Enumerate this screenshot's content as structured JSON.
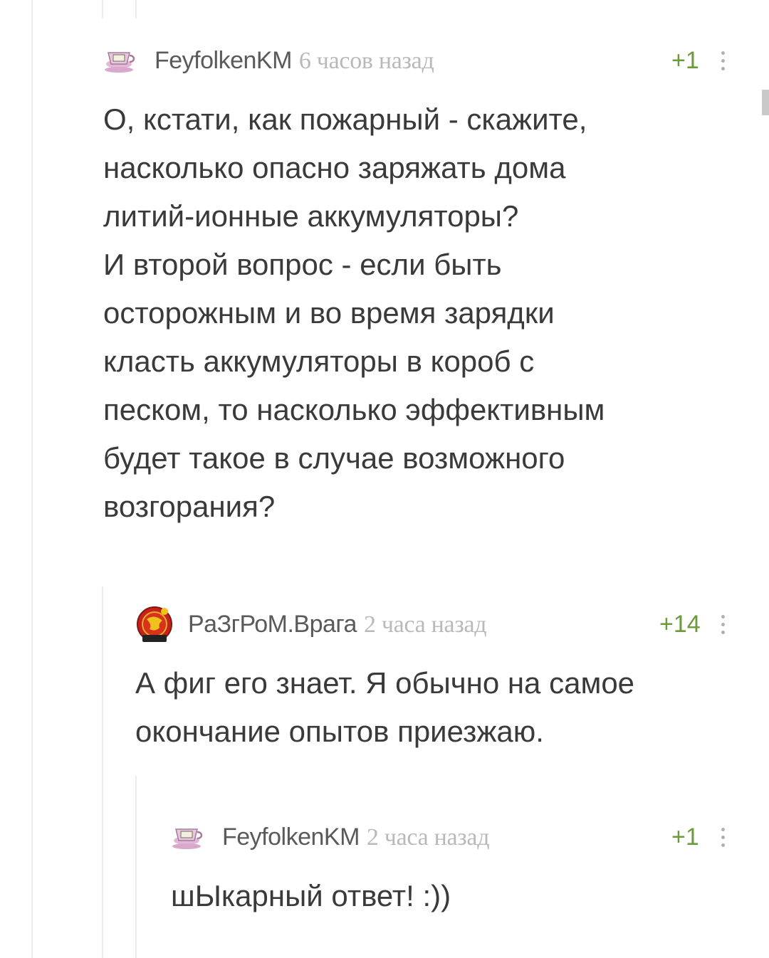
{
  "comments": [
    {
      "author": "FeyfolkenKM",
      "time": "6 часов назад",
      "rating": "+1",
      "text": "О, кстати, как пожарный - скажите,\nнасколько опасно заряжать дома\nлитий-ионные аккумуляторы?\nИ второй вопрос - если быть\nосторожным и во время зарядки\nкласть аккумуляторы в короб с\nпеском, то насколько эффективным\nбудет такое в случае возможного\nвозгорания?",
      "avatar_icon": "teacup-avatar-icon"
    },
    {
      "author": "PaЗгРоМ.Врага",
      "time": "2 часа назад",
      "rating": "+14",
      "text": "А фиг его знает. Я обычно на самое\nокончание опытов приезжаю.",
      "avatar_icon": "emblem-avatar-icon"
    },
    {
      "author": "FeyfolkenKM",
      "time": "2 часа назад",
      "rating": "+1",
      "text": "шЫкарный ответ! :))",
      "avatar_icon": "teacup-avatar-icon"
    }
  ],
  "colors": {
    "rating": "#6b9b3a",
    "time": "#b9b9b9",
    "text": "#3a3a3a",
    "thread_line": "#ececec"
  }
}
